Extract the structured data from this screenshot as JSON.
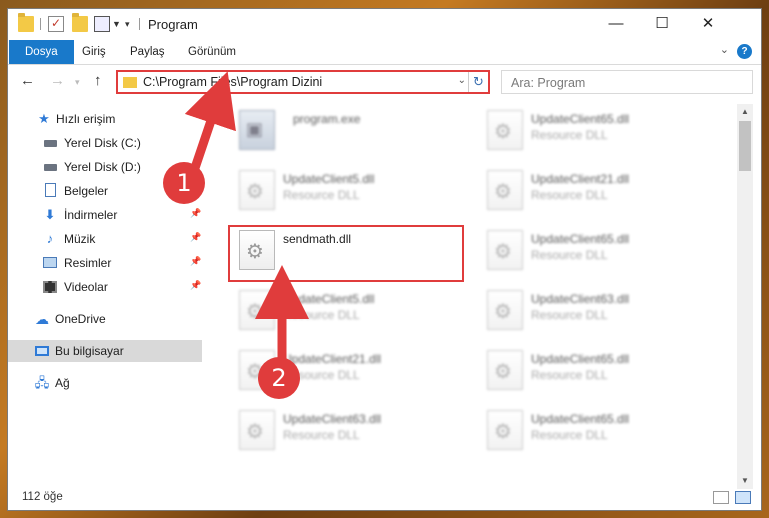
{
  "window": {
    "title": "Program"
  },
  "ribbon": {
    "tabs": [
      "Dosya",
      "Giriş",
      "Paylaş",
      "Görünüm"
    ]
  },
  "nav": {
    "address": "C:\\Program Files\\Program Dizini",
    "search_placeholder": "Ara: Program"
  },
  "sidebar": {
    "items": [
      {
        "label": "Hızlı erişim",
        "icon": "star-icon"
      },
      {
        "label": "Yerel Disk (C:)",
        "icon": "drive-icon"
      },
      {
        "label": "Yerel Disk (D:)",
        "icon": "drive-icon"
      },
      {
        "label": "Belgeler",
        "icon": "documents-icon"
      },
      {
        "label": "İndirmeler",
        "icon": "download-icon"
      },
      {
        "label": "Müzik",
        "icon": "music-icon"
      },
      {
        "label": "Resimler",
        "icon": "pictures-icon"
      },
      {
        "label": "Videolar",
        "icon": "videos-icon"
      },
      {
        "label": "OneDrive",
        "icon": "cloud-icon"
      },
      {
        "label": "Bu bilgisayar",
        "icon": "computer-icon"
      },
      {
        "label": "Ağ",
        "icon": "network-icon"
      }
    ]
  },
  "files": [
    {
      "name": "program.exe",
      "type": ""
    },
    {
      "name": "UpdateClient65.dll",
      "type": "Resource DLL"
    },
    {
      "name": "UpdateClient5.dll",
      "type": "Resource DLL"
    },
    {
      "name": "UpdateClient21.dll",
      "type": "Resource DLL"
    },
    {
      "name": "sendmath.dll",
      "type": ""
    },
    {
      "name": "UpdateClient65.dll",
      "type": "Resource DLL"
    },
    {
      "name": "UpdateClient5.dll",
      "type": "Resource DLL"
    },
    {
      "name": "UpdateClient63.dll",
      "type": "Resource DLL"
    },
    {
      "name": "UpdateClient21.dll",
      "type": "Resource DLL"
    },
    {
      "name": "UpdateClient65.dll",
      "type": "Resource DLL"
    },
    {
      "name": "UpdateClient63.dll",
      "type": "Resource DLL"
    },
    {
      "name": "UpdateClient65.dll",
      "type": "Resource DLL"
    }
  ],
  "status": {
    "count": "112 öğe"
  },
  "annotations": {
    "step1": "1",
    "step2": "2"
  },
  "colors": {
    "accent": "#1979ca",
    "annotation": "#e03c3c"
  }
}
